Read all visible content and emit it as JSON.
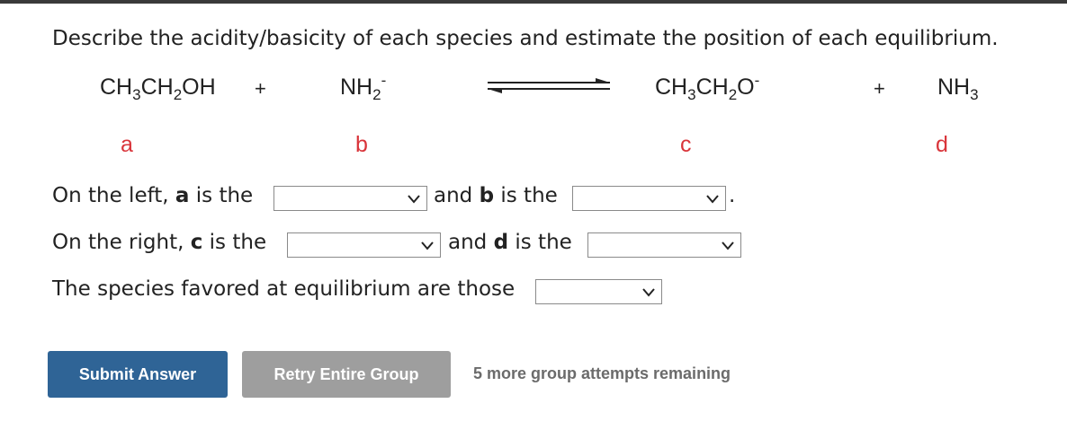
{
  "question": "Describe the acidity/basicity of each species and estimate the position of each equilibrium.",
  "equation": {
    "reactant_a": {
      "p1": "CH",
      "s1": "3",
      "p2": "CH",
      "s2": "2",
      "p3": "OH"
    },
    "plus1": "+",
    "reactant_b": {
      "p1": "NH",
      "s1": "2",
      "charge": "-"
    },
    "product_c": {
      "p1": "CH",
      "s1": "3",
      "p2": "CH",
      "s2": "2",
      "p3": "O",
      "charge": "-"
    },
    "plus2": "+",
    "product_d": {
      "p1": "NH",
      "s1": "3"
    },
    "labels": {
      "a": "a",
      "b": "b",
      "c": "c",
      "d": "d"
    }
  },
  "lines": {
    "left": {
      "t1": "On the left, ",
      "a": "a",
      "t2": " is the",
      "t3": "and ",
      "b": "b",
      "t4": " is the",
      "end": "."
    },
    "right": {
      "t1": "On the right, ",
      "c": "c",
      "t2": " is the",
      "t3": "and ",
      "d": "d",
      "t4": " is the"
    },
    "favored": {
      "text": "The species favored at equilibrium are those"
    }
  },
  "dropdowns": {
    "a_value": "",
    "b_value": "",
    "c_value": "",
    "d_value": "",
    "favored_value": ""
  },
  "buttons": {
    "submit": "Submit Answer",
    "retry": "Retry Entire Group"
  },
  "attempts_text": "5 more group attempts remaining",
  "colors": {
    "label_red": "#d9343a",
    "submit_bg": "#2f6496",
    "retry_bg": "#9e9e9e",
    "attempts_gray": "#6b6b6b"
  }
}
